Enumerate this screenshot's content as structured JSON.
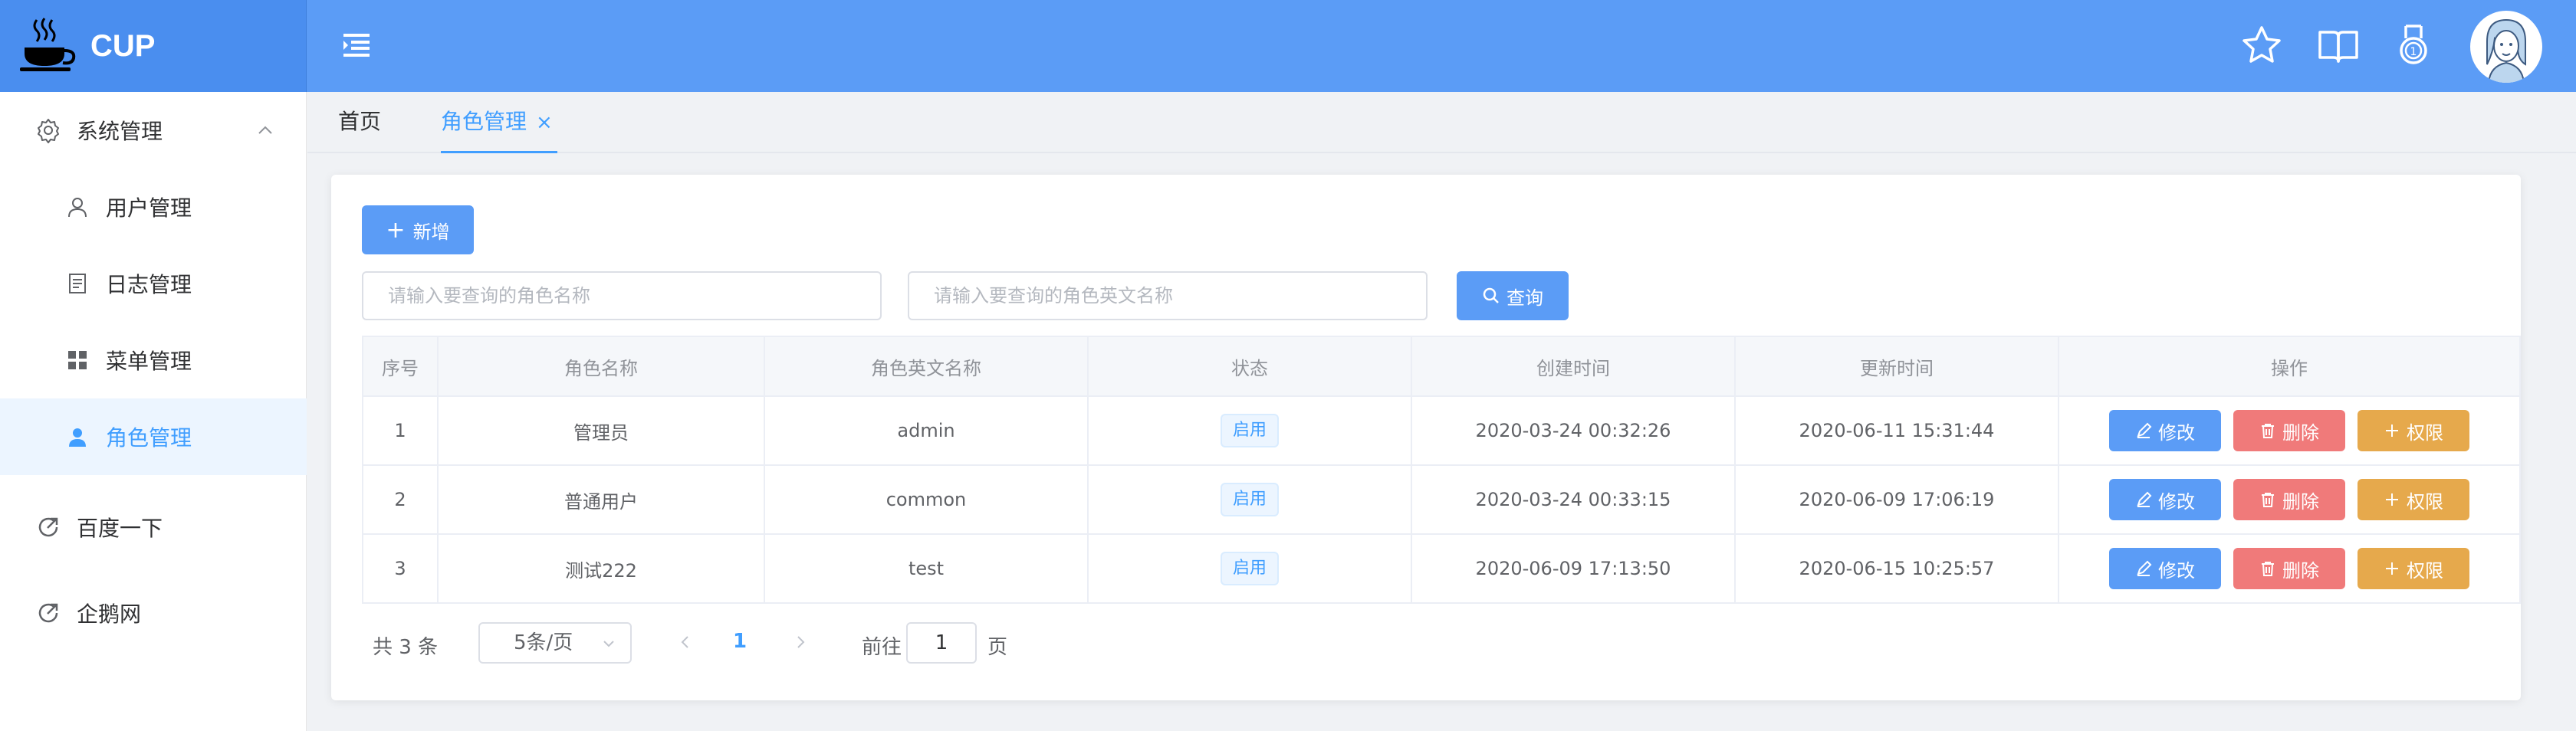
{
  "app": {
    "logo_text": "CUP"
  },
  "header": {
    "icons": [
      "menu-toggle-icon",
      "star-icon",
      "book-icon",
      "medal-icon"
    ],
    "accent": "#5b9cf6"
  },
  "sidebar": {
    "group": {
      "label": "系统管理",
      "icon": "gear-icon"
    },
    "items": [
      {
        "label": "用户管理",
        "icon": "user-icon"
      },
      {
        "label": "日志管理",
        "icon": "document-icon"
      },
      {
        "label": "菜单管理",
        "icon": "grid-icon"
      },
      {
        "label": "角色管理",
        "icon": "user-filled-icon",
        "active": true
      }
    ],
    "links": [
      {
        "label": "百度一下",
        "icon": "link-icon"
      },
      {
        "label": "企鹅网",
        "icon": "link-icon"
      }
    ]
  },
  "tabs": [
    {
      "label": "首页"
    },
    {
      "label": "角色管理",
      "close": "×",
      "active": true
    }
  ],
  "toolbar": {
    "add_label": "新增",
    "role_name_placeholder": "请输入要查询的角色名称",
    "role_en_placeholder": "请输入要查询的角色英文名称",
    "search_label": "查询"
  },
  "table": {
    "columns": [
      "序号",
      "角色名称",
      "角色英文名称",
      "状态",
      "创建时间",
      "更新时间",
      "操作"
    ],
    "rows": [
      {
        "index": "1",
        "name": "管理员",
        "en": "admin",
        "status": "启用",
        "created": "2020-03-24 00:32:26",
        "updated": "2020-06-11 15:31:44"
      },
      {
        "index": "2",
        "name": "普通用户",
        "en": "common",
        "status": "启用",
        "created": "2020-03-24 00:33:15",
        "updated": "2020-06-09 17:06:19"
      },
      {
        "index": "3",
        "name": "测试222",
        "en": "test",
        "status": "启用",
        "created": "2020-06-09 17:13:50",
        "updated": "2020-06-15 10:25:57"
      }
    ],
    "actions": {
      "edit": "修改",
      "delete": "删除",
      "perm": "权限"
    }
  },
  "pagination": {
    "total": "共 3 条",
    "page_size": "5条/页",
    "current_page": "1",
    "goto_label": "前往",
    "goto_value": "1",
    "page_suffix": "页"
  },
  "colors": {
    "primary": "#5b9cf6",
    "danger": "#f07a7a",
    "warning": "#e6a94c"
  }
}
